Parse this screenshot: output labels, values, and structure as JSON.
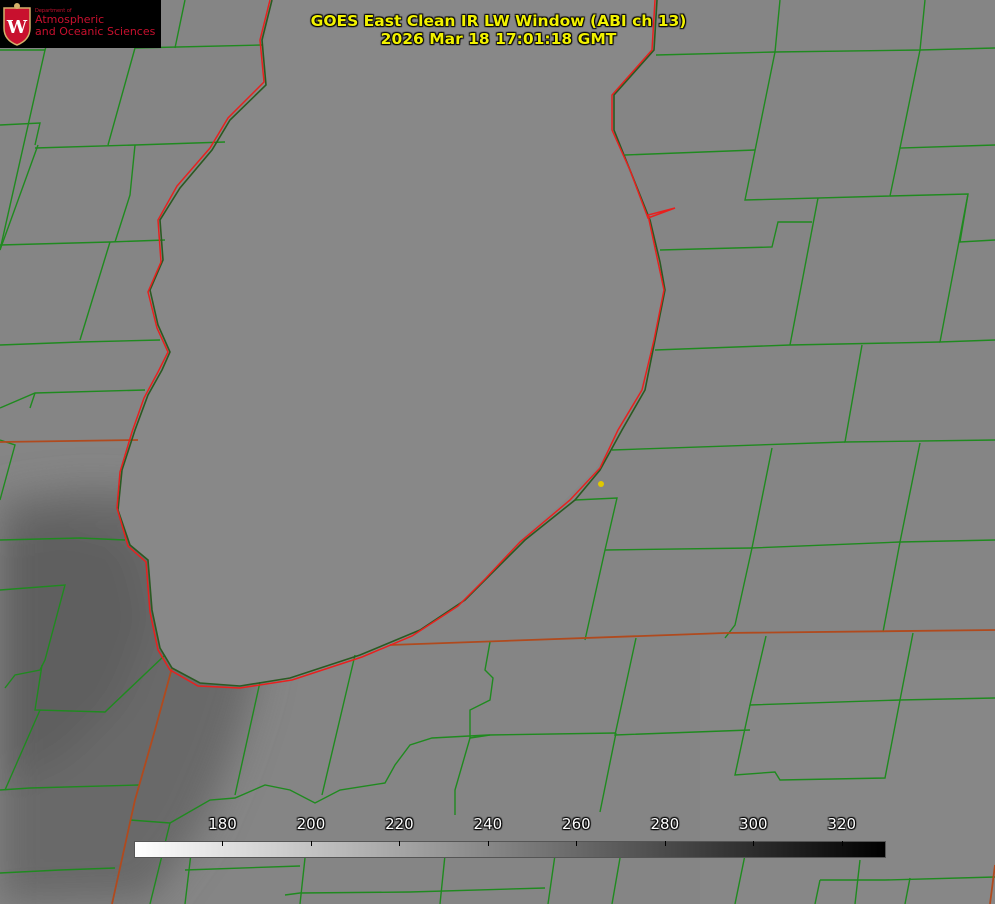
{
  "title": {
    "line1": "GOES East Clean IR LW Window (ABI ch 13)",
    "line2": "2026 Mar 18 17:01:18 GMT"
  },
  "logo": {
    "department": "Department of",
    "line1": "Atmospheric",
    "line2": "and Oceanic Sciences",
    "seal_letter": "W"
  },
  "colorbar": {
    "min": 160,
    "max": 330,
    "labels": [
      "180",
      "200",
      "220",
      "240",
      "260",
      "280",
      "300",
      "320"
    ],
    "values": [
      180,
      200,
      220,
      240,
      260,
      280,
      300,
      320
    ],
    "colormap": "white-to-black (warm = dark)"
  },
  "colors": {
    "background_gray": "#858585",
    "lake_gray": "#888888",
    "cold_cloud_gray": "#6a6a6a",
    "county_lines": "#1f8a1f",
    "state_lines": "#b04a1e",
    "coastline": "#e8201e",
    "title_text": "#f2f200",
    "marker": "#e0c800"
  },
  "map": {
    "feature": "Lake Michigan outline with county and state boundaries",
    "marker": "yellow-dot"
  }
}
